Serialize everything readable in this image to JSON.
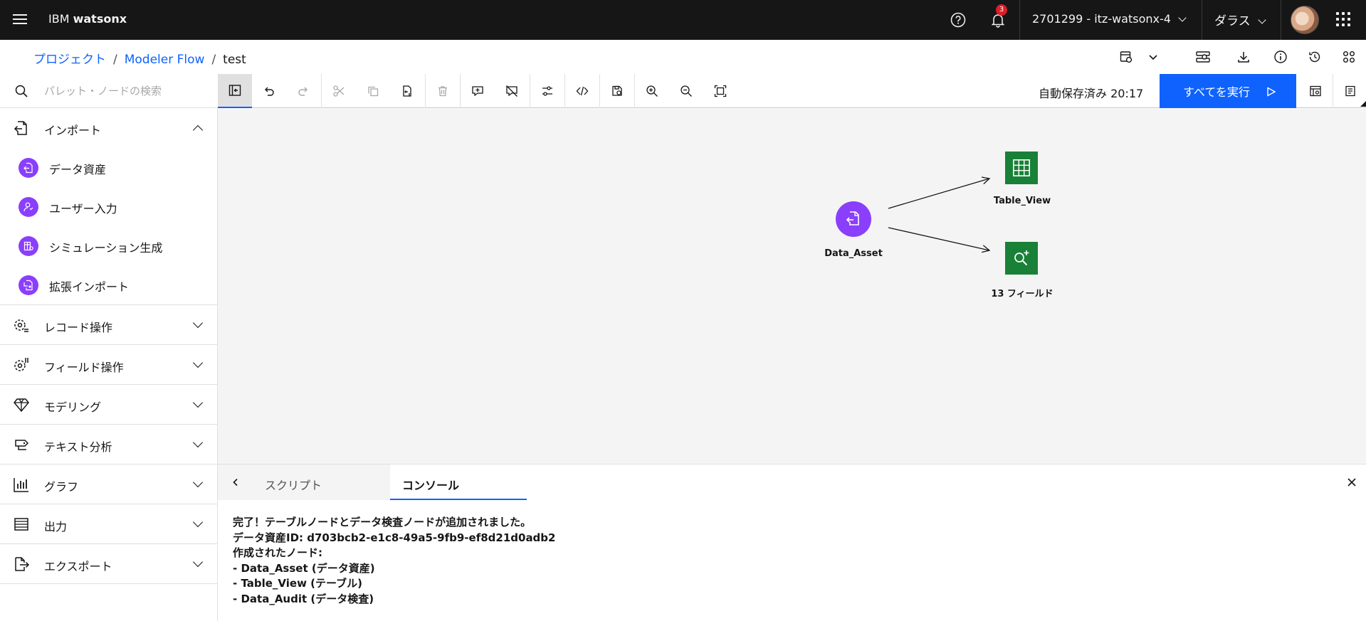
{
  "header": {
    "brand_prefix": "IBM",
    "brand_name": "watsonx",
    "notification_count": "3",
    "account": "2701299 - itz-watsonx-4",
    "region": "ダラス"
  },
  "breadcrumb": {
    "items": [
      "プロジェクト",
      "Modeler Flow"
    ],
    "separator": "/",
    "current": "test"
  },
  "palette": {
    "search_placeholder": "パレット・ノードの検索",
    "categories": [
      {
        "label": "インポート",
        "expanded": true,
        "icon": "import-icon"
      },
      {
        "label": "レコード操作",
        "icon": "record-ops-icon"
      },
      {
        "label": "フィールド操作",
        "icon": "field-ops-icon"
      },
      {
        "label": "モデリング",
        "icon": "modeling-icon"
      },
      {
        "label": "テキスト分析",
        "icon": "text-analytics-icon"
      },
      {
        "label": "グラフ",
        "icon": "graph-icon"
      },
      {
        "label": "出力",
        "icon": "output-icon"
      },
      {
        "label": "エクスポート",
        "icon": "export-icon"
      }
    ],
    "import_nodes": [
      {
        "label": "データ資産",
        "icon": "data-asset-icon"
      },
      {
        "label": "ユーザー入力",
        "icon": "user-input-icon"
      },
      {
        "label": "シミュレーション生成",
        "icon": "simulation-icon"
      },
      {
        "label": "拡張インポート",
        "icon": "extension-import-icon"
      }
    ]
  },
  "toolbar": {
    "autosave": "自動保存済み 20:17",
    "run_all": "すべてを実行"
  },
  "canvas": {
    "nodes": [
      {
        "label": "Data_Asset",
        "color": "#8a3ffc"
      },
      {
        "label": "Table_View",
        "color": "#198038"
      },
      {
        "label": "13 フィールド",
        "color": "#198038"
      }
    ]
  },
  "bottom_panel": {
    "tabs": [
      "スクリプト",
      "コンソール"
    ],
    "active_tab": "コンソール",
    "console_lines": [
      "完了！テーブルノードとデータ検査ノードが追加されました。",
      "データ資産ID: d703bcb2-e1c8-49a5-9fb9-ef8d21d0adb2",
      "作成されたノード:",
      "- Data_Asset (データ資産)",
      "- Table_View (テーブル)",
      "- Data_Audit (データ検査)"
    ]
  },
  "colors": {
    "accent": "#0f62fe",
    "header_bg": "#161616",
    "badge": "#da1e28",
    "import_purple": "#8a3ffc",
    "output_green": "#198038"
  }
}
